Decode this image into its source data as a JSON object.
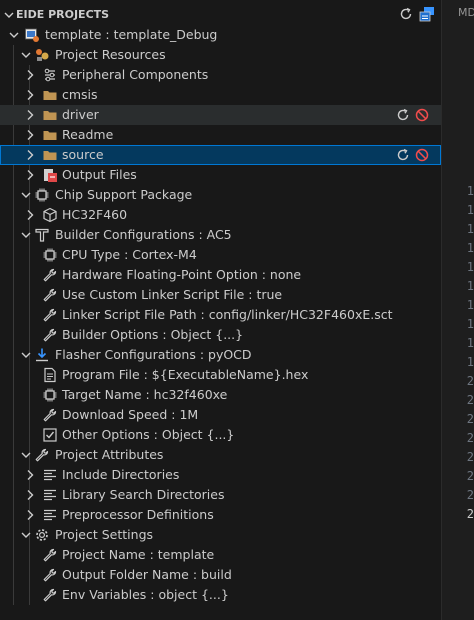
{
  "panel": {
    "title": "EIDE PROJECTS"
  },
  "tree": [
    {
      "label": "template : template_Debug",
      "depth": 0,
      "chevron": "down",
      "icon": "project-icon"
    },
    {
      "label": "Project Resources",
      "depth": 1,
      "chevron": "down",
      "icon": "resources-icon"
    },
    {
      "label": "Peripheral Components",
      "depth": 2,
      "chevron": "right",
      "icon": "components-icon"
    },
    {
      "label": "cmsis",
      "depth": 2,
      "chevron": "right",
      "icon": "folder-icon"
    },
    {
      "label": "driver",
      "depth": 2,
      "chevron": "right",
      "icon": "folder-icon",
      "state": "hover",
      "actions": true
    },
    {
      "label": "Readme",
      "depth": 2,
      "chevron": "right",
      "icon": "folder-icon"
    },
    {
      "label": "source",
      "depth": 2,
      "chevron": "right",
      "icon": "folder-icon",
      "state": "selected",
      "actions": true
    },
    {
      "label": "Output Files",
      "depth": 2,
      "chevron": "right",
      "icon": "output-files-icon"
    },
    {
      "label": "Chip Support Package",
      "depth": 1,
      "chevron": "down",
      "icon": "chip-icon"
    },
    {
      "label": "HC32F460",
      "depth": 2,
      "chevron": "right",
      "icon": "package-icon"
    },
    {
      "label": "Builder Configurations : AC5",
      "depth": 1,
      "chevron": "down",
      "icon": "builder-icon"
    },
    {
      "label": "CPU Type : Cortex-M4",
      "depth": 2,
      "icon": "chip-icon"
    },
    {
      "label": "Hardware Floating-Point Option : none",
      "depth": 2,
      "icon": "wrench-icon"
    },
    {
      "label": "Use Custom Linker Script File : true",
      "depth": 2,
      "icon": "wrench-icon"
    },
    {
      "label": "Linker Script File Path : config/linker/HC32F460xE.sct",
      "depth": 2,
      "icon": "wrench-icon"
    },
    {
      "label": "Builder Options : Object {...}",
      "depth": 2,
      "icon": "wrench-icon"
    },
    {
      "label": "Flasher Configurations : pyOCD",
      "depth": 1,
      "chevron": "down",
      "icon": "download-icon"
    },
    {
      "label": "Program File : ${ExecutableName}.hex",
      "depth": 2,
      "icon": "file-icon"
    },
    {
      "label": "Target Name : hc32f460xe",
      "depth": 2,
      "icon": "chip-icon"
    },
    {
      "label": "Download Speed : 1M",
      "depth": 2,
      "icon": "wrench-icon"
    },
    {
      "label": "Other Options : Object {...}",
      "depth": 2,
      "icon": "options-icon"
    },
    {
      "label": "Project Attributes",
      "depth": 1,
      "chevron": "down",
      "icon": "wrench-icon"
    },
    {
      "label": "Include Directories",
      "depth": 2,
      "chevron": "right",
      "icon": "list-icon"
    },
    {
      "label": "Library Search Directories",
      "depth": 2,
      "chevron": "right",
      "icon": "list-icon"
    },
    {
      "label": "Preprocessor Definitions",
      "depth": 2,
      "chevron": "right",
      "icon": "list-icon"
    },
    {
      "label": "Project Settings",
      "depth": 1,
      "chevron": "down",
      "icon": "gear-icon"
    },
    {
      "label": "Project Name : template",
      "depth": 2,
      "icon": "wrench-icon"
    },
    {
      "label": "Output Folder Name : build",
      "depth": 2,
      "icon": "wrench-icon"
    },
    {
      "label": "Env Variables : object {...}",
      "depth": 2,
      "icon": "wrench-icon"
    }
  ],
  "editor": {
    "tab_label": "MD",
    "line_numbers": [
      "1",
      "1",
      "1",
      "1",
      "1",
      "1",
      "1",
      "1",
      "1",
      "1",
      "2",
      "2",
      "2",
      "2",
      "2",
      "2",
      "2",
      "2"
    ],
    "current_line_index": 17
  },
  "colors": {
    "accent": "#0078d4",
    "selected_bg": "#04395e",
    "hover_bg": "#2a2d2e",
    "danger": "#f14c4c",
    "folder": "#c09553"
  }
}
